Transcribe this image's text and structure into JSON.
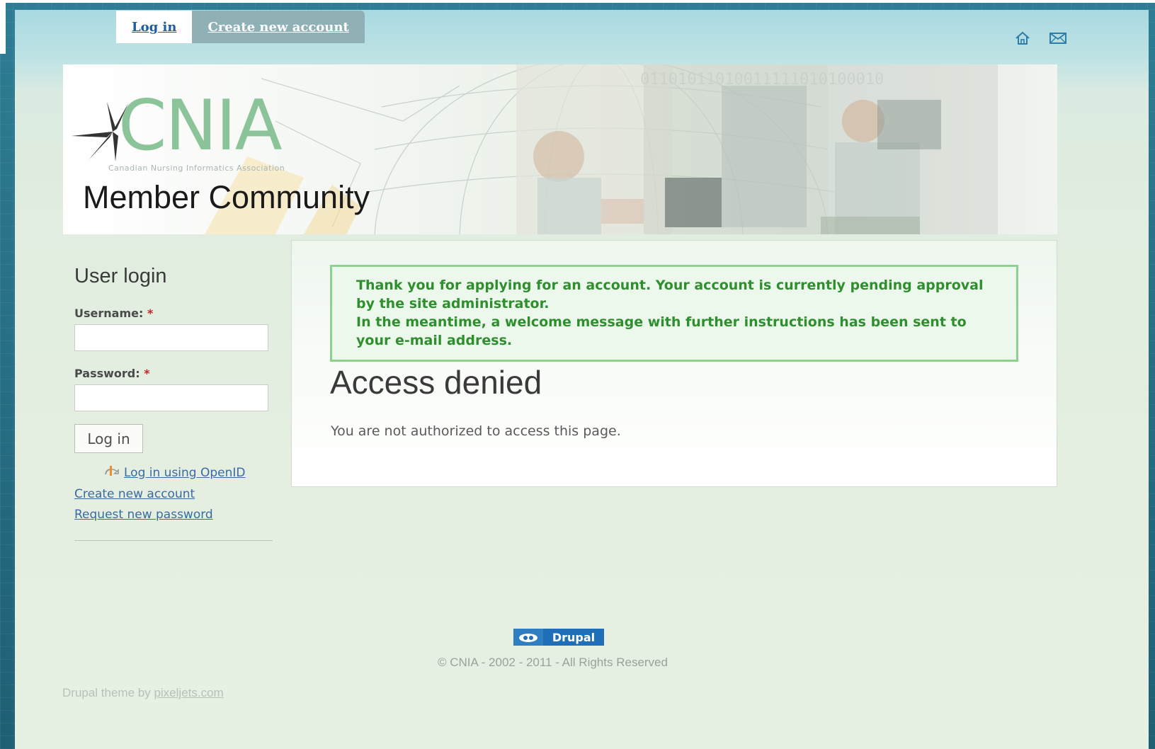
{
  "tabs": {
    "login_label": "Log in",
    "create_label": "Create new account"
  },
  "top_icons": [
    "home-icon",
    "mail-icon"
  ],
  "banner": {
    "logo_text": "CNIA",
    "logo_subtitle": "Canadian Nursing Informatics Association",
    "title": "Member Community",
    "binary_text": "01101011010011111010100010"
  },
  "sidebar": {
    "title": "User login",
    "username_label": "Username:",
    "password_label": "Password:",
    "required_mark": "*",
    "login_button": "Log in",
    "openid_link": "Log in using OpenID",
    "create_account_link": "Create new account",
    "request_password_link": "Request new password"
  },
  "main": {
    "message_line1": "Thank you for applying for an account. Your account is currently pending approval by the site administrator.",
    "message_line2": "In the meantime, a welcome message with further instructions has been sent to your e-mail address.",
    "heading": "Access denied",
    "body": "You are not authorized to access this page."
  },
  "footer": {
    "drupal_badge": "Drupal",
    "copyright": "© CNIA - 2002 - 2011 - All Rights Reserved",
    "theme_credit_prefix": "Drupal theme by ",
    "theme_credit_link": "pixeljets.com"
  },
  "colors": {
    "link": "#3b6aa0",
    "message_green": "#2f8f2f",
    "logo_green": "#8cc49a",
    "drupal_blue": "#1f6fb8"
  }
}
